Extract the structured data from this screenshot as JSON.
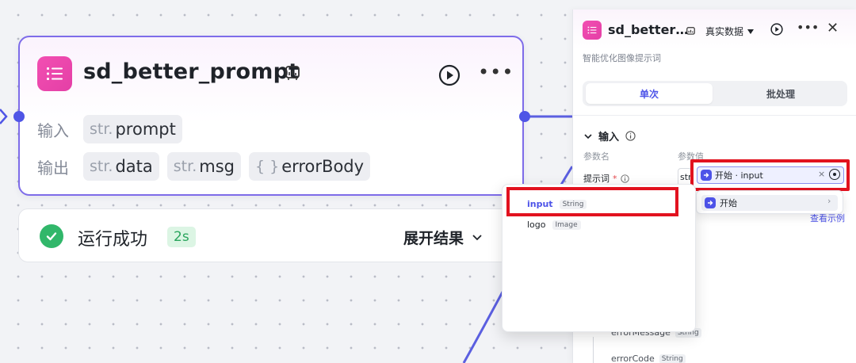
{
  "node": {
    "title": "sd_better_prompt",
    "input_label": "输入",
    "output_label": "输出",
    "inputs": [
      {
        "type": "str.",
        "name": "prompt"
      }
    ],
    "outputs": [
      {
        "type": "str.",
        "name": "data"
      },
      {
        "type": "str.",
        "name": "msg"
      },
      {
        "type": "{ }",
        "name": "errorBody"
      }
    ]
  },
  "run": {
    "status": "运行成功",
    "time": "2s",
    "expand_label": "展开结果"
  },
  "panel": {
    "title": "sd_better…",
    "data_mode": "真实数据",
    "description": "智能优化图像提示词",
    "tabs": [
      {
        "label": "单次",
        "active": true
      },
      {
        "label": "批处理",
        "active": false
      }
    ],
    "input_section": "输入",
    "col_name": "参数名",
    "col_value": "参数值",
    "param_label": "提示词",
    "param_required": "*",
    "param_value_prefix": "str",
    "ref_value": "开始 · input",
    "ref_dropdown_item": "开始",
    "view_example": "查看示例",
    "under_items": [
      {
        "name": "errorMessage",
        "type": "String"
      },
      {
        "name": "errorCode",
        "type": "String"
      }
    ]
  },
  "dropdown": {
    "items": [
      {
        "name": "input",
        "type": "String",
        "selected": true
      },
      {
        "name": "logo",
        "type": "Image",
        "selected": false
      }
    ]
  },
  "colors": {
    "accent": "#4d53e8",
    "brand_pink": "#f24fb2",
    "success": "#31b76a",
    "highlight": "#e2121f",
    "node_border": "#7e6ce9"
  }
}
